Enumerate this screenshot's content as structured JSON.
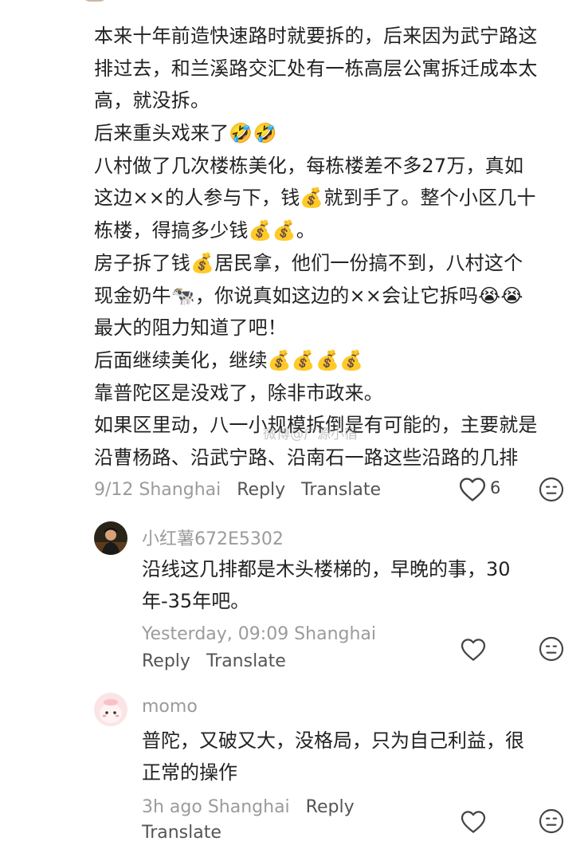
{
  "main_comment": {
    "lines": [
      "本来十年前造快速路时就要拆的，后来因为武宁路这",
      "排过去，和兰溪路交汇处有一栋高层公寓拆迁成本太",
      "高，就没拆。",
      "后来重头戏来了🤣🤣",
      "八村做了几次楼栋美化，每栋楼差不多27万，真如",
      "这边××的人参与下，钱💰就到手了。整个小区几十",
      "栋楼，得搞多少钱💰💰。",
      "房子拆了钱💰居民拿，他们一份搞不到，八村这个",
      "现金奶牛🐄，你说真如这边的××会让它拆吗😭😭",
      "最大的阻力知道了吧！",
      "后面继续美化，继续💰💰💰💰",
      "靠普陀区是没戏了，除非市政来。",
      "如果区里动，八一小规模拆倒是有可能的，主要就是",
      "沿曹杨路、沿武宁路、沿南石一路这些沿路的几排"
    ],
    "date": "9/12 Shanghai",
    "reply_label": "Reply",
    "translate_label": "Translate",
    "like_count": "6"
  },
  "watermark": "微博@广源小宿",
  "replies": [
    {
      "username": "小红薯672E5302",
      "lines": [
        "沿线这几排都是木头楼梯的，早晚的事，30",
        "年-35年吧。"
      ],
      "date": "Yesterday, 09:09 Shanghai",
      "reply_label": "Reply",
      "translate_label": "Translate"
    },
    {
      "username": "momo",
      "lines": [
        "普陀，又破又大，没格局，只为自己利益，很",
        "正常的操作"
      ],
      "date": "3h ago Shanghai",
      "reply_label": "Reply",
      "translate_label": "Translate"
    }
  ],
  "icons": {
    "like": "heart-outline-icon",
    "dislike": "neutral-face-icon",
    "avatar_1": "user-photo-avatar",
    "avatar_2": "pink-character-avatar"
  }
}
